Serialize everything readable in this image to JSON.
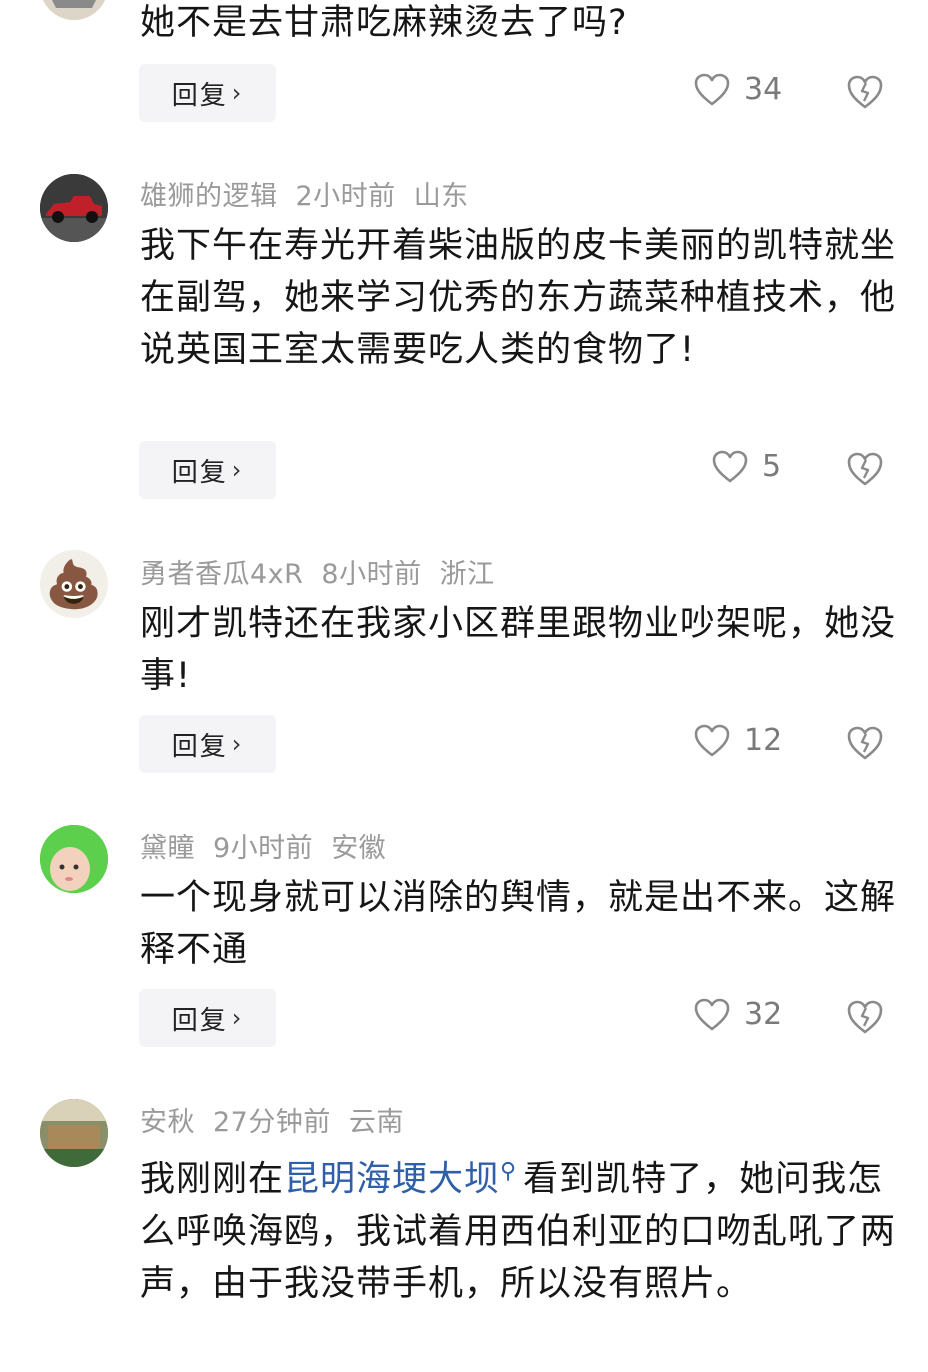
{
  "comments": [
    {
      "text": "她不是去甘肃吃麻辣烫去了吗?",
      "reply_label": "回复",
      "likes": "34"
    },
    {
      "user": "雄狮的逻辑",
      "time": "2小时前",
      "location": "山东",
      "text": "我下午在寿光开着柴油版的皮卡美丽的凯特就坐在副驾，她来学习优秀的东方蔬菜种植技术，他说英国王室太需要吃人类的食物了!",
      "reply_label": "回复",
      "likes": "5"
    },
    {
      "user": "勇者香瓜4xR",
      "time": "8小时前",
      "location": "浙江",
      "text": "刚才凯特还在我家小区群里跟物业吵架呢，她没事!",
      "reply_label": "回复",
      "likes": "12",
      "avatar_emoji": "💩"
    },
    {
      "user": "黛瞳",
      "time": "9小时前",
      "location": "安徽",
      "text": "一个现身就可以消除的舆情，就是出不来。这解释不通",
      "reply_label": "回复",
      "likes": "32"
    },
    {
      "user": "安秋",
      "time": "27分钟前",
      "location": "云南",
      "text_before": "我刚刚在",
      "text_link": "昆明海埂大坝",
      "text_after": "看到凯特了，她问我怎么呼唤海鸥，我试着用西伯利亚的口吻乱吼了两声，由于我没带手机，所以没有照片。"
    }
  ],
  "icons": {
    "like": "heart-outline-icon",
    "dislike": "broken-heart-icon",
    "reply_chevron": "chevron-right-icon",
    "link_search": "search-icon"
  },
  "colors": {
    "meta": "#9a9a9a",
    "link": "#2f5fa8",
    "reply_bg": "#f4f4f6"
  }
}
